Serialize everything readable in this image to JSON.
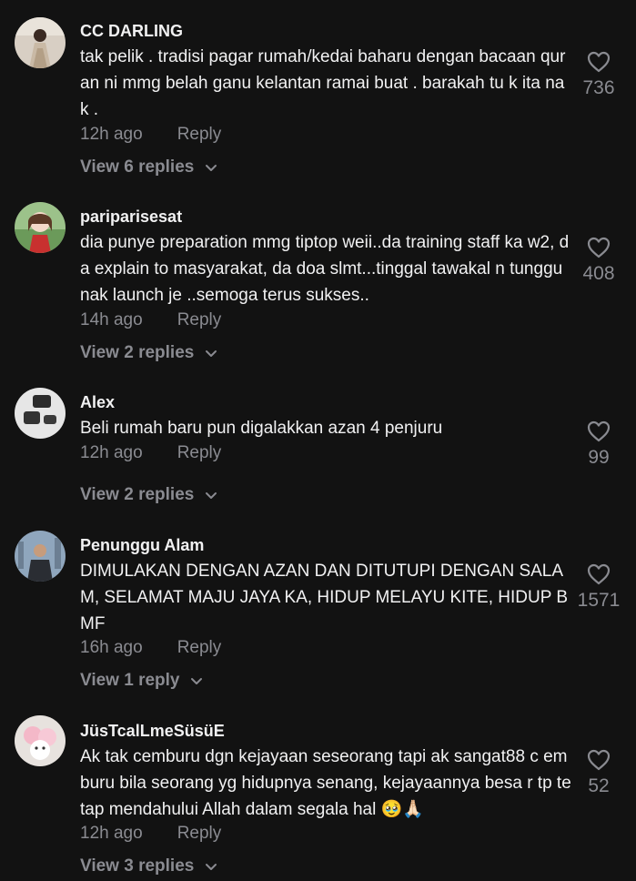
{
  "colors": {
    "background": "#121212",
    "primary_text": "#f1f1f2",
    "secondary_text": "#8a8b91"
  },
  "comments": [
    {
      "username": "CC DARLING",
      "text": "tak pelik . tradisi pagar rumah/kedai baharu dengan bacaan quran ni mmg belah ganu kelantan ramai buat . barakah tu k ita nak .",
      "time": "12h ago",
      "reply_label": "Reply",
      "view_replies": "View 6 replies",
      "likes": "736",
      "avatar_icon": "avatar-photo-icon"
    },
    {
      "username": "pariparisesat",
      "text": "dia punye preparation mmg tiptop weii..da training staff ka w2, da explain to masyarakat, da doa slmt...tinggal tawakal n tunggu nak launch je ..semoga terus sukses..",
      "time": "14h ago",
      "reply_label": "Reply",
      "view_replies": "View 2 replies",
      "likes": "408",
      "avatar_icon": "avatar-photo-icon"
    },
    {
      "username": "Alex",
      "text": "Beli rumah baru pun digalakkan azan 4 penjuru",
      "time": "12h ago",
      "reply_label": "Reply",
      "view_replies": "View 2 replies",
      "likes": "99",
      "avatar_icon": "avatar-photo-icon"
    },
    {
      "username": "Penunggu Alam",
      "text": "DIMULAKAN DENGAN AZAN DAN DITUTUPI DENGAN SALA M, SELAMAT MAJU JAYA KA, HIDUP MELAYU KITE, HIDUP B MF",
      "time": "16h ago",
      "reply_label": "Reply",
      "view_replies": "View 1 reply",
      "likes": "1571",
      "avatar_icon": "avatar-photo-icon"
    },
    {
      "username": "JüsTcalLmeSüsüE",
      "text": "Ak tak cemburu dgn kejayaan seseorang tapi ak sangat88 c emburu bila seorang yg hidupnya senang, kejayaannya besa r tp tetap mendahului Allah dalam segala hal 🥹🙏🏻",
      "time": "12h ago",
      "reply_label": "Reply",
      "view_replies": "View 3 replies",
      "likes": "52",
      "avatar_icon": "avatar-photo-icon"
    }
  ]
}
